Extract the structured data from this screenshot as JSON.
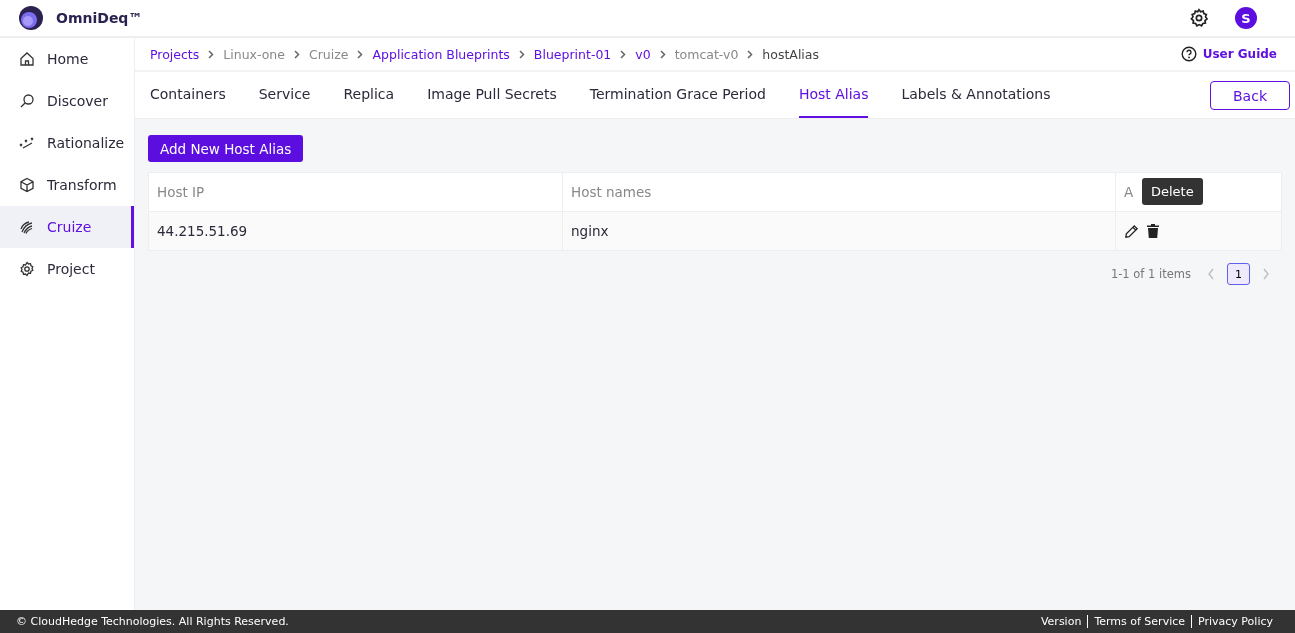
{
  "app": {
    "name": "OmniDeq™",
    "avatar": "S"
  },
  "sidebar": {
    "items": [
      {
        "label": "Home",
        "selected": false
      },
      {
        "label": "Discover",
        "selected": false
      },
      {
        "label": "Rationalize",
        "selected": false
      },
      {
        "label": "Transform",
        "selected": false
      },
      {
        "label": "Cruize",
        "selected": true
      },
      {
        "label": "Project",
        "selected": false
      }
    ]
  },
  "breadcrumb": [
    {
      "label": "Projects",
      "kind": "link"
    },
    {
      "label": "Linux-one",
      "kind": "text"
    },
    {
      "label": "Cruize",
      "kind": "text"
    },
    {
      "label": "Application Blueprints",
      "kind": "link"
    },
    {
      "label": "Blueprint-01",
      "kind": "link"
    },
    {
      "label": "v0",
      "kind": "link"
    },
    {
      "label": "tomcat-v0",
      "kind": "text"
    },
    {
      "label": "hostAlias",
      "kind": "current"
    }
  ],
  "user_guide": "User Guide",
  "tabs": [
    {
      "label": "Containers",
      "selected": false
    },
    {
      "label": "Service",
      "selected": false
    },
    {
      "label": "Replica",
      "selected": false
    },
    {
      "label": "Image Pull Secrets",
      "selected": false
    },
    {
      "label": "Termination Grace Period",
      "selected": false
    },
    {
      "label": "Host Alias",
      "selected": true
    },
    {
      "label": "Labels & Annotations",
      "selected": false
    }
  ],
  "back_button": "Back",
  "add_button": "Add New Host Alias",
  "table": {
    "columns": [
      "Host IP",
      "Host names",
      "A"
    ],
    "rows": [
      {
        "host_ip": "44.215.51.69",
        "host_names": "nginx"
      }
    ]
  },
  "tooltip": "Delete",
  "pagination": {
    "summary": "1-1 of 1 items",
    "pages": [
      {
        "label": "1",
        "selected": true
      }
    ]
  },
  "footer": {
    "copyright": "© CloudHedge Technologies. All Rights Reserved.",
    "links": [
      "Version",
      "Terms of Service",
      "Privacy Policy"
    ]
  }
}
